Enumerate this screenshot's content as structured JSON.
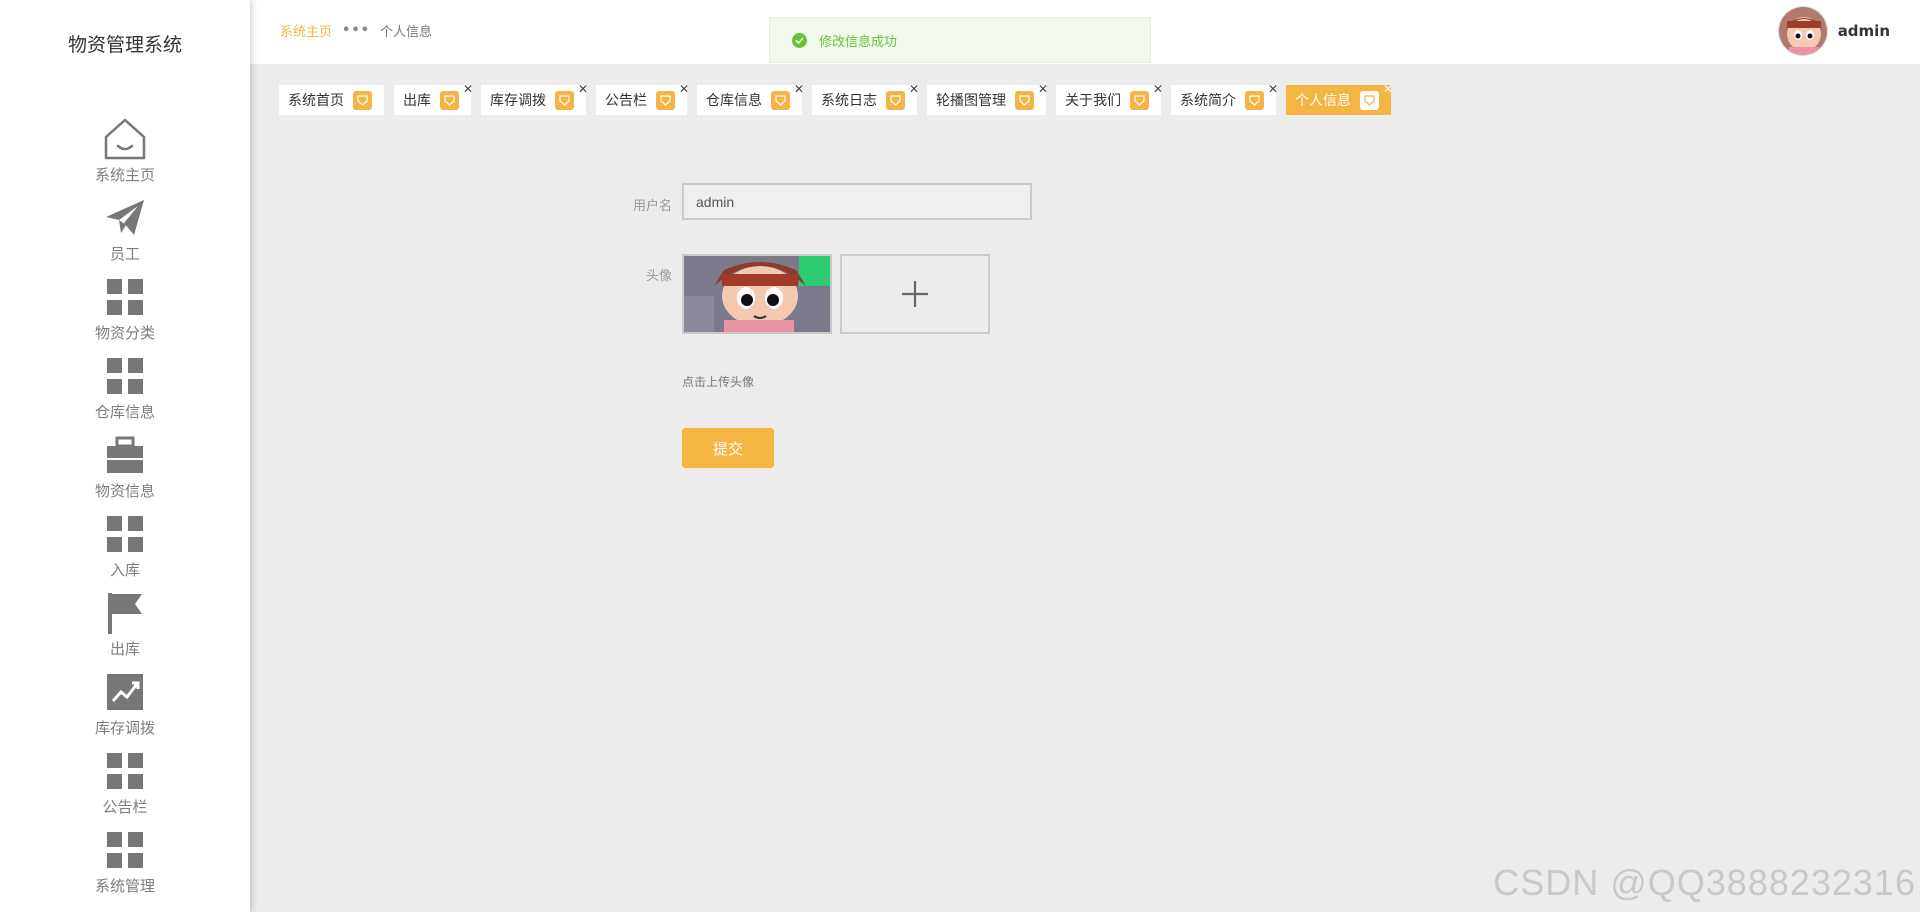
{
  "app": {
    "title": "物资管理系统"
  },
  "sidebar": {
    "items": [
      {
        "label": "系统主页",
        "icon": "home-icon"
      },
      {
        "label": "员工",
        "icon": "paper-plane-icon"
      },
      {
        "label": "物资分类",
        "icon": "grid-icon"
      },
      {
        "label": "仓库信息",
        "icon": "grid-icon"
      },
      {
        "label": "物资信息",
        "icon": "briefcase-icon"
      },
      {
        "label": "入库",
        "icon": "grid-icon"
      },
      {
        "label": "出库",
        "icon": "flag-icon"
      },
      {
        "label": "库存调拨",
        "icon": "chart-line-icon"
      },
      {
        "label": "公告栏",
        "icon": "grid-icon"
      },
      {
        "label": "系统管理",
        "icon": "grid-icon"
      }
    ]
  },
  "header": {
    "breadcrumb": {
      "home": "系统主页",
      "separator": "•••",
      "current": "个人信息"
    },
    "user": {
      "name": "admin"
    }
  },
  "toast": {
    "message": "修改信息成功",
    "type": "success"
  },
  "tabs": [
    {
      "label": "系统首页",
      "closable": false,
      "active": false
    },
    {
      "label": "出库",
      "closable": true,
      "active": false
    },
    {
      "label": "库存调拨",
      "closable": true,
      "active": false
    },
    {
      "label": "公告栏",
      "closable": true,
      "active": false
    },
    {
      "label": "仓库信息",
      "closable": true,
      "active": false
    },
    {
      "label": "系统日志",
      "closable": true,
      "active": false
    },
    {
      "label": "轮播图管理",
      "closable": true,
      "active": false
    },
    {
      "label": "关于我们",
      "closable": true,
      "active": false
    },
    {
      "label": "系统简介",
      "closable": true,
      "active": false
    },
    {
      "label": "个人信息",
      "closable": true,
      "active": true
    }
  ],
  "form": {
    "username_label": "用户名",
    "username_value": "admin",
    "avatar_label": "头像",
    "upload_hint": "点击上传头像",
    "submit_label": "提交"
  },
  "watermark": "CSDN @QQ3888232316",
  "colors": {
    "accent": "#f5b544",
    "success": "#67c23a",
    "background": "#ececec"
  }
}
